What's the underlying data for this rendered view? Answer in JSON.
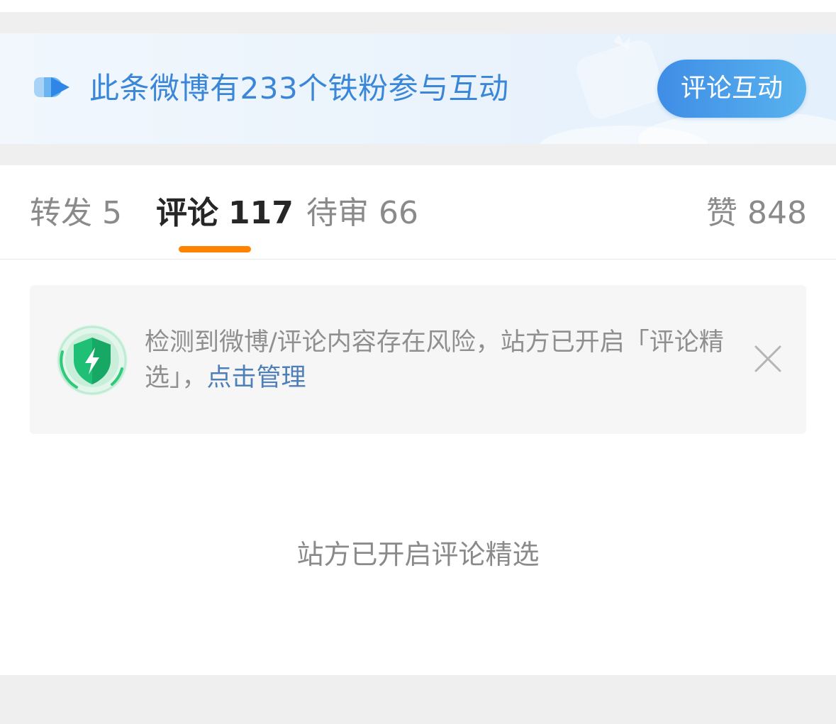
{
  "banner": {
    "text": "此条微博有233个铁粉参与互动",
    "button_label": "评论互动",
    "accent_color": "#3a86d8"
  },
  "tabs": [
    {
      "label": "转发",
      "count": "5",
      "active": false
    },
    {
      "label": "评论",
      "count": "117",
      "active": true
    },
    {
      "label": "待审",
      "count": "66",
      "active": false
    }
  ],
  "likes": {
    "label": "赞",
    "count": "848"
  },
  "active_tab_indicator_color": "#ff8200",
  "notice": {
    "icon": "shield-bolt-icon",
    "text": "检测到微博/评论内容存在风险，站方已开启「评论精选」，",
    "link_text": "点击管理",
    "close_icon": "close-icon"
  },
  "empty_state": {
    "text": "站方已开启评论精选"
  }
}
